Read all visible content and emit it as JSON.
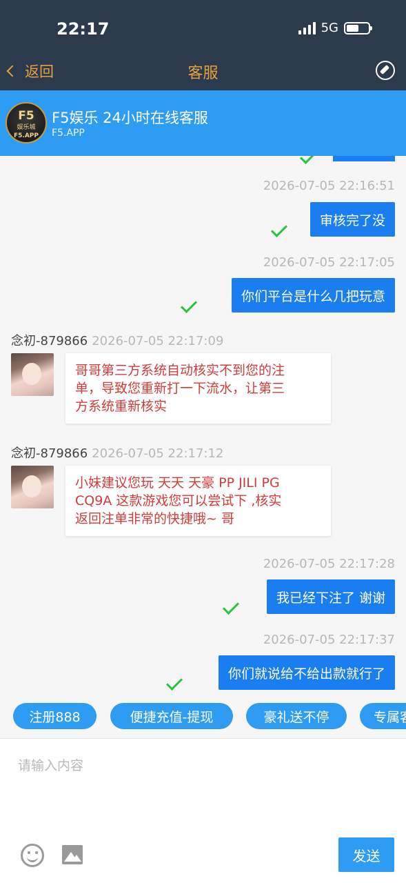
{
  "status_bar": {
    "time": "22:17",
    "network": "5G",
    "battery_level": 0.55
  },
  "nav": {
    "back_label": "返回",
    "title": "客服"
  },
  "header": {
    "logo": {
      "top": "F5",
      "middle": "娱乐城",
      "bottom": "F5.APP"
    },
    "title": "F5娱乐 24小时在线客服",
    "subtitle": "F5.APP"
  },
  "messages": [
    {
      "type": "outgoing",
      "time": "2026-07-05 22:16:51",
      "text": "审核完了没"
    },
    {
      "type": "outgoing",
      "time": "2026-07-05 22:17:05",
      "text": "你们平台是什么几把玩意"
    },
    {
      "type": "incoming",
      "sender": "念初-879866",
      "time": "2026-07-05 22:17:09",
      "lines": [
        "哥哥第三方系统自动核实不到您的注",
        "单，导致您重新打一下流水，让第三",
        "方系统重新核实"
      ]
    },
    {
      "type": "incoming",
      "sender": "念初-879866",
      "time": "2026-07-05 22:17:12",
      "lines": [
        "小妹建议您玩 天天  天豪 PP  JILI PG",
        "CQ9A   这款游戏您可以尝试下 ,核实",
        "返回注单非常的快捷哦~ 哥"
      ]
    },
    {
      "type": "outgoing",
      "time": "2026-07-05 22:17:28",
      "text": "我已经下注了 谢谢"
    },
    {
      "type": "outgoing",
      "time": "2026-07-05 22:17:37",
      "text": "你们就说给不给出款就行了"
    }
  ],
  "quick_buttons": [
    "注册888",
    "便捷充值-提现",
    "豪礼送不停",
    "专属客"
  ],
  "input": {
    "placeholder": "请输入内容",
    "send_label": "发送"
  },
  "colors": {
    "nav_bg": "#2b3a4d",
    "accent": "#e7a13b",
    "header_bg": "#2d9cf2",
    "outgoing_bubble": "#1a7ef0",
    "incoming_text": "#d23b3b",
    "check": "#29c43c"
  }
}
